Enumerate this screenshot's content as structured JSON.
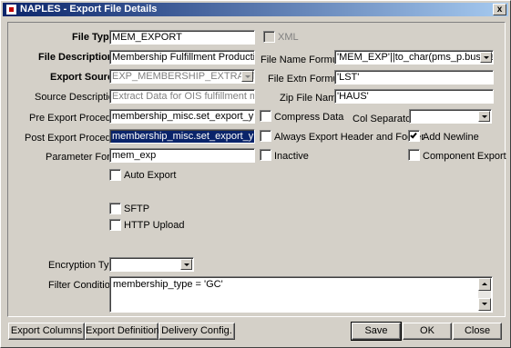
{
  "window": {
    "title": "NAPLES - Export File Details",
    "close_glyph": "x"
  },
  "file_type": {
    "label": "File Type",
    "value": "MEM_EXPORT"
  },
  "xml": {
    "label": "XML",
    "checked": false
  },
  "file_description": {
    "label": "File Description",
    "value": "Membership Fulfillment Production Ex"
  },
  "file_name_formula": {
    "label": "File Name Formula",
    "value": "'MEM_EXP'||to_char(pms_p.business_"
  },
  "export_source": {
    "label": "Export Source",
    "value": "EXP_MEMBERSHIP_EXTRACTS"
  },
  "file_extn_formula": {
    "label": "File Extn Formula",
    "value": "'LST'"
  },
  "source_description": {
    "label": "Source Description",
    "value": "Extract Data for OIS fulfillment membe"
  },
  "zip_file_name": {
    "label": "Zip File Name",
    "value": "'HAUS'"
  },
  "pre_export_procedure": {
    "label": "Pre Export Procedure",
    "value": "membership_misc.set_export_yn_flag"
  },
  "compress_data": {
    "label": "Compress Data",
    "checked": false
  },
  "col_separator": {
    "label": "Col Separator",
    "value": ""
  },
  "post_export_procedure": {
    "label": "Post Export Procedure",
    "value": "membership_misc.set_export_yn_flag"
  },
  "always_export_header": {
    "label": "Always Export Header and Footer",
    "checked": false
  },
  "add_newline": {
    "label": "Add Newline",
    "checked": true
  },
  "parameter_form": {
    "label": "Parameter Form",
    "value": "mem_exp"
  },
  "inactive": {
    "label": "Inactive",
    "checked": false
  },
  "component_export": {
    "label": "Component Export",
    "checked": false
  },
  "auto_export": {
    "label": "Auto Export",
    "checked": false
  },
  "sftp": {
    "label": "SFTP",
    "checked": false
  },
  "http_upload": {
    "label": "HTTP Upload",
    "checked": false
  },
  "encryption_type": {
    "label": "Encryption Type",
    "value": ""
  },
  "filter_condition": {
    "label": "Filter Condition",
    "value": "membership_type = 'GC'"
  },
  "buttons": {
    "export_columns": "Export Columns",
    "export_definitions": "Export Definitions",
    "delivery_config": "Delivery Config.",
    "save": "Save",
    "ok": "OK",
    "close": "Close"
  },
  "colors": {
    "title_start": "#0a246a",
    "title_end": "#a6caf0",
    "face": "#d4d0c8",
    "selection": "#0a246a"
  },
  "icons": [
    "app-icon",
    "close-icon",
    "chevron-down-icon",
    "check-icon",
    "scroll-up-icon",
    "scroll-down-icon"
  ]
}
